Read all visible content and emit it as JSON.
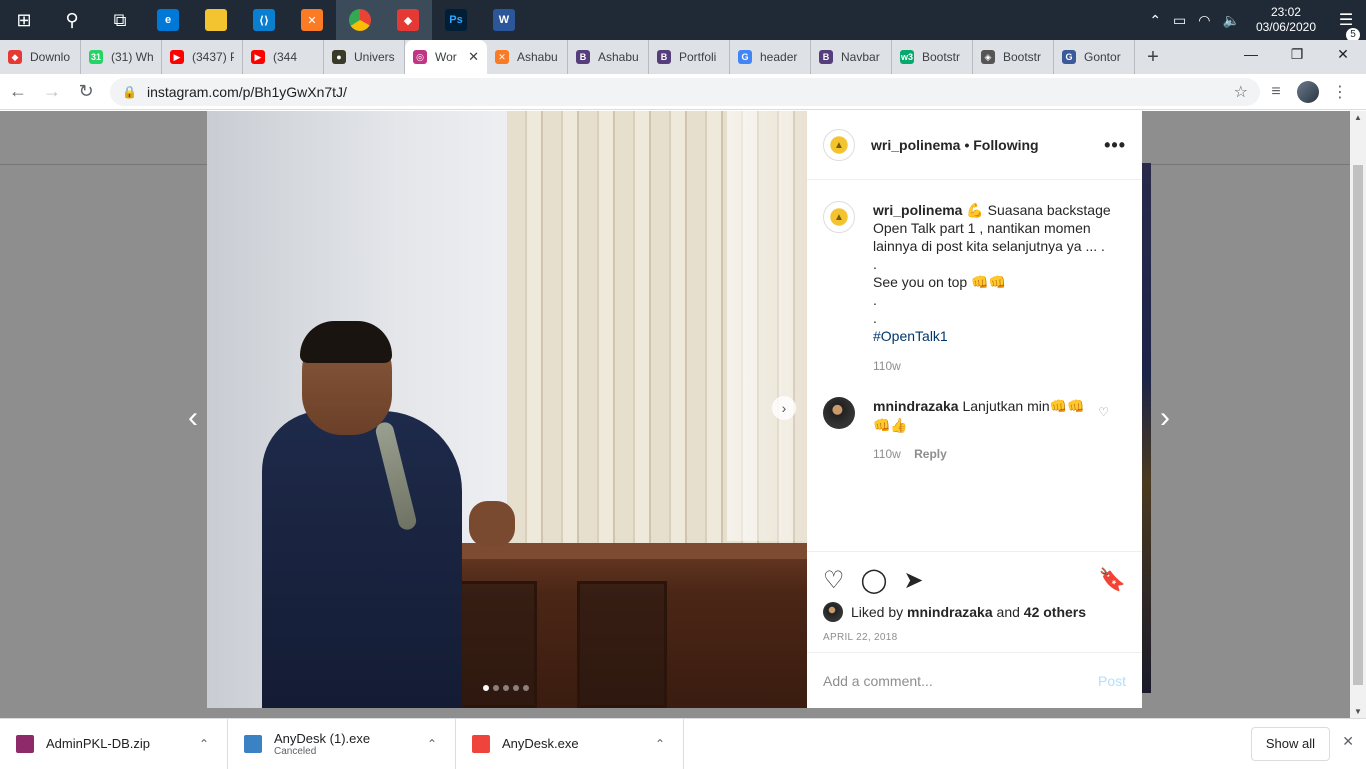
{
  "taskbar": {
    "apps": [
      {
        "name": "start",
        "glyph": "⊞"
      },
      {
        "name": "search",
        "glyph": "⚲"
      },
      {
        "name": "task-view",
        "glyph": "⧉"
      },
      {
        "name": "edge",
        "glyph": "e"
      },
      {
        "name": "file-explorer",
        "glyph": "▬"
      },
      {
        "name": "vscode",
        "glyph": "⟨⟩"
      },
      {
        "name": "xampp",
        "glyph": "✕"
      },
      {
        "name": "chrome",
        "glyph": "◉"
      },
      {
        "name": "app-red",
        "glyph": "◆"
      },
      {
        "name": "photoshop",
        "glyph": "Ps"
      },
      {
        "name": "word",
        "glyph": "W"
      }
    ],
    "time": "23:02",
    "date": "03/06/2020",
    "notification_count": "5"
  },
  "tabs": [
    {
      "label": "Downlo",
      "fav": "◆",
      "color": "#e53935"
    },
    {
      "label": "(31) Wh",
      "fav": "31",
      "color": "#25d366"
    },
    {
      "label": "(3437) P",
      "fav": "▶",
      "color": "#ff0000"
    },
    {
      "label": "(344",
      "fav": "▶",
      "color": "#ff0000"
    },
    {
      "label": "Univers",
      "fav": "●",
      "color": "#3a3a2a"
    },
    {
      "label": "Wor",
      "fav": "◎",
      "color": "#c13584",
      "active": true
    },
    {
      "label": "Ashabu",
      "fav": "✕",
      "color": "#fb7a24"
    },
    {
      "label": "Ashabu",
      "fav": "B",
      "color": "#563d7c"
    },
    {
      "label": "Portfoli",
      "fav": "B",
      "color": "#563d7c"
    },
    {
      "label": "header",
      "fav": "G",
      "color": "#4285f4"
    },
    {
      "label": "Navbar",
      "fav": "B",
      "color": "#563d7c"
    },
    {
      "label": "Bootstr",
      "fav": "w3",
      "color": "#04aa6d"
    },
    {
      "label": "Bootstr",
      "fav": "◈",
      "color": "#555555"
    },
    {
      "label": "Gontor",
      "fav": "G",
      "color": "#3c5a99"
    }
  ],
  "address": {
    "url": "instagram.com/p/Bh1yGwXn7tJ/"
  },
  "post": {
    "username": "wri_polinema",
    "follow_status": "• Following",
    "more": "•••",
    "caption_user": "wri_polinema",
    "caption_lines": [
      "💪 Suasana backstage Open Talk part 1 , nantikan momen lainnya di post kita selanjutnya ya ... .",
      ".",
      "See you on top 👊👊",
      ".",
      "."
    ],
    "hashtag": "#OpenTalk1",
    "caption_age": "110w",
    "comment_user": "mnindrazaka",
    "comment_text": "Lanjutkan min👊👊👊👍",
    "comment_age": "110w",
    "comment_reply": "Reply",
    "liked_by_prefix": "Liked by",
    "liked_by_user": "mnindrazaka",
    "liked_by_and": "and",
    "liked_by_others": "42 others",
    "date": "APRIL 22, 2018",
    "add_comment_placeholder": "Add a comment...",
    "post_button": "Post"
  },
  "downloads": [
    {
      "name": "AdminPKL-DB.zip",
      "sub": "",
      "icon_color": "#8e2a6a"
    },
    {
      "name": "AnyDesk (1).exe",
      "sub": "Canceled",
      "icon_color": "#3b82c4"
    },
    {
      "name": "AnyDesk.exe",
      "sub": "",
      "icon_color": "#ef443b"
    }
  ],
  "show_all": "Show all"
}
